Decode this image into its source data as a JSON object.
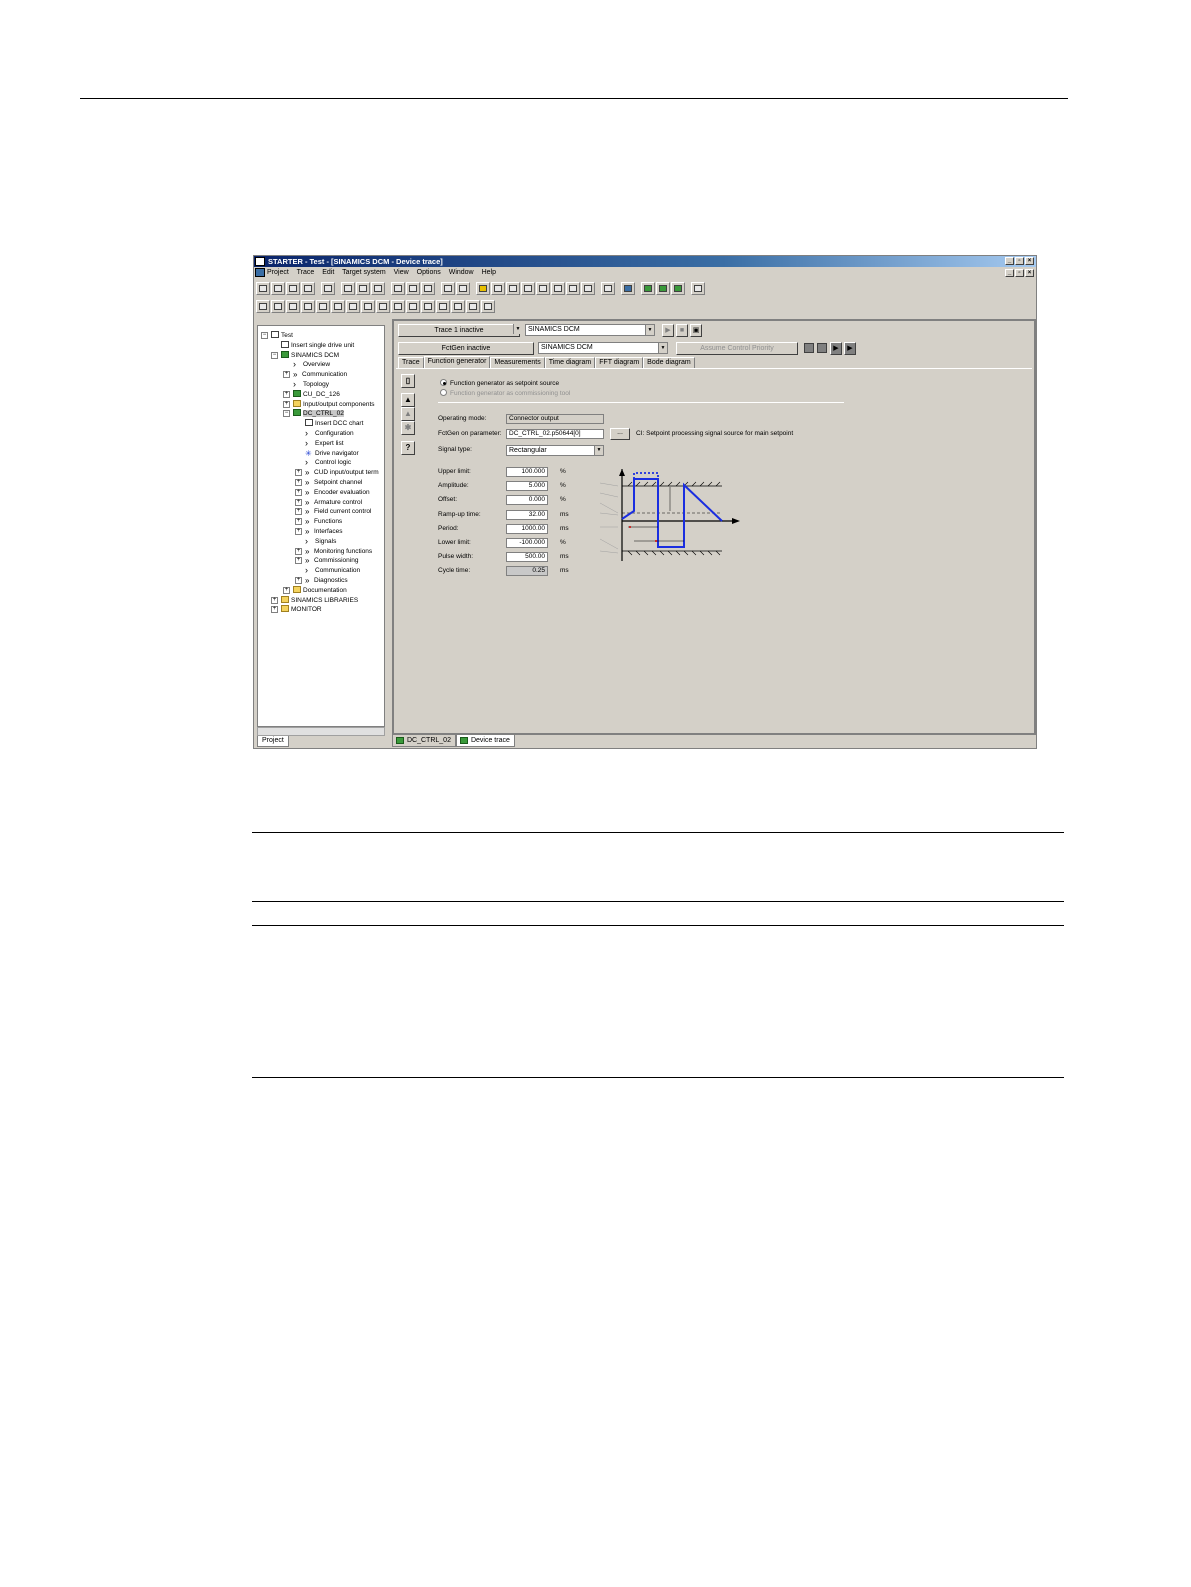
{
  "window": {
    "title": "STARTER - Test - [SINAMICS DCM - Device trace]",
    "menu": [
      "Project",
      "Trace",
      "Edit",
      "Target system",
      "View",
      "Options",
      "Window",
      "Help"
    ]
  },
  "tree": {
    "items": [
      {
        "label": "Test",
        "level": 0,
        "exp": "−",
        "icon": "doc"
      },
      {
        "label": "Insert single drive unit",
        "level": 1,
        "icon": "doc"
      },
      {
        "label": "SINAMICS DCM",
        "level": 1,
        "exp": "−",
        "icon": "drive"
      },
      {
        "label": "Overview",
        "level": 2,
        "icon": "one"
      },
      {
        "label": "Communication",
        "level": 2,
        "exp": "+",
        "icon": "chev"
      },
      {
        "label": "Topology",
        "level": 2,
        "icon": "one"
      },
      {
        "label": "CU_DC_126",
        "level": 2,
        "exp": "+",
        "icon": "drive"
      },
      {
        "label": "Input/output components",
        "level": 2,
        "exp": "+",
        "icon": "folder"
      },
      {
        "label": "DC_CTRL_02",
        "level": 2,
        "exp": "−",
        "icon": "drive",
        "selected": true
      },
      {
        "label": "Insert DCC chart",
        "level": 3,
        "icon": "doc"
      },
      {
        "label": "Configuration",
        "level": 3,
        "icon": "one"
      },
      {
        "label": "Expert list",
        "level": 3,
        "icon": "one"
      },
      {
        "label": "Drive navigator",
        "level": 3,
        "icon": "star"
      },
      {
        "label": "Control logic",
        "level": 3,
        "icon": "one"
      },
      {
        "label": "CUD input/output  term",
        "level": 3,
        "exp": "+",
        "icon": "chev"
      },
      {
        "label": "Setpoint channel",
        "level": 3,
        "exp": "+",
        "icon": "chev"
      },
      {
        "label": "Encoder evaluation",
        "level": 3,
        "exp": "+",
        "icon": "chev"
      },
      {
        "label": "Armature control",
        "level": 3,
        "exp": "+",
        "icon": "chev"
      },
      {
        "label": "Field current control",
        "level": 3,
        "exp": "+",
        "icon": "chev"
      },
      {
        "label": "Functions",
        "level": 3,
        "exp": "+",
        "icon": "chev"
      },
      {
        "label": "Interfaces",
        "level": 3,
        "exp": "+",
        "icon": "chev"
      },
      {
        "label": "Signals",
        "level": 3,
        "icon": "one"
      },
      {
        "label": "Monitoring functions",
        "level": 3,
        "exp": "+",
        "icon": "chev"
      },
      {
        "label": "Commissioning",
        "level": 3,
        "exp": "+",
        "icon": "chev"
      },
      {
        "label": "Communication",
        "level": 3,
        "icon": "one"
      },
      {
        "label": "Diagnostics",
        "level": 3,
        "exp": "+",
        "icon": "chev"
      },
      {
        "label": "Documentation",
        "level": 2,
        "exp": "+",
        "icon": "folder"
      },
      {
        "label": "SINAMICS LIBRARIES",
        "level": 1,
        "exp": "+",
        "icon": "folder"
      },
      {
        "label": "MONITOR",
        "level": 1,
        "exp": "+",
        "icon": "folder"
      }
    ],
    "project_tab": "Project"
  },
  "trace": {
    "status_button": "Trace 1 inactive",
    "device": "SINAMICS DCM",
    "fctgen_button": "FctGen inactive",
    "fctgen_device": "SINAMICS DCM",
    "control_priority": "Assume Control Priority"
  },
  "tabs": [
    "Trace",
    "Function generator",
    "Measurements",
    "Time diagram",
    "FFT diagram",
    "Bode diagram"
  ],
  "function_generator": {
    "radio_setpoint": "Function generator as setpoint source",
    "radio_commissioning": "Function generator as commissioning tool",
    "operating_mode_label": "Operating mode:",
    "operating_mode_value": "Connector output",
    "parameter_label": "FctGen on parameter:",
    "parameter_value": "DC_CTRL_02.p50644[0]",
    "browse_label": "...",
    "parameter_desc": "CI: Setpoint processing signal source for main setpoint",
    "signal_type_label": "Signal type:",
    "signal_type_value": "Rectangular",
    "fields": [
      {
        "label": "Upper limit:",
        "value": "100.000",
        "unit": "%"
      },
      {
        "label": "Amplitude:",
        "value": "5.000",
        "unit": "%"
      },
      {
        "label": "Offset:",
        "value": "0.000",
        "unit": "%"
      },
      {
        "label": "Ramp-up time:",
        "value": "32.00",
        "unit": "ms"
      },
      {
        "label": "Period:",
        "value": "1000.00",
        "unit": "ms"
      },
      {
        "label": "Lower limit:",
        "value": "-100.000",
        "unit": "%"
      },
      {
        "label": "Pulse width:",
        "value": "500.00",
        "unit": "ms"
      },
      {
        "label": "Cycle time:",
        "value": "0.25",
        "unit": "ms"
      }
    ]
  },
  "doc_tabs": [
    "DC_CTRL_02",
    "Device trace"
  ]
}
